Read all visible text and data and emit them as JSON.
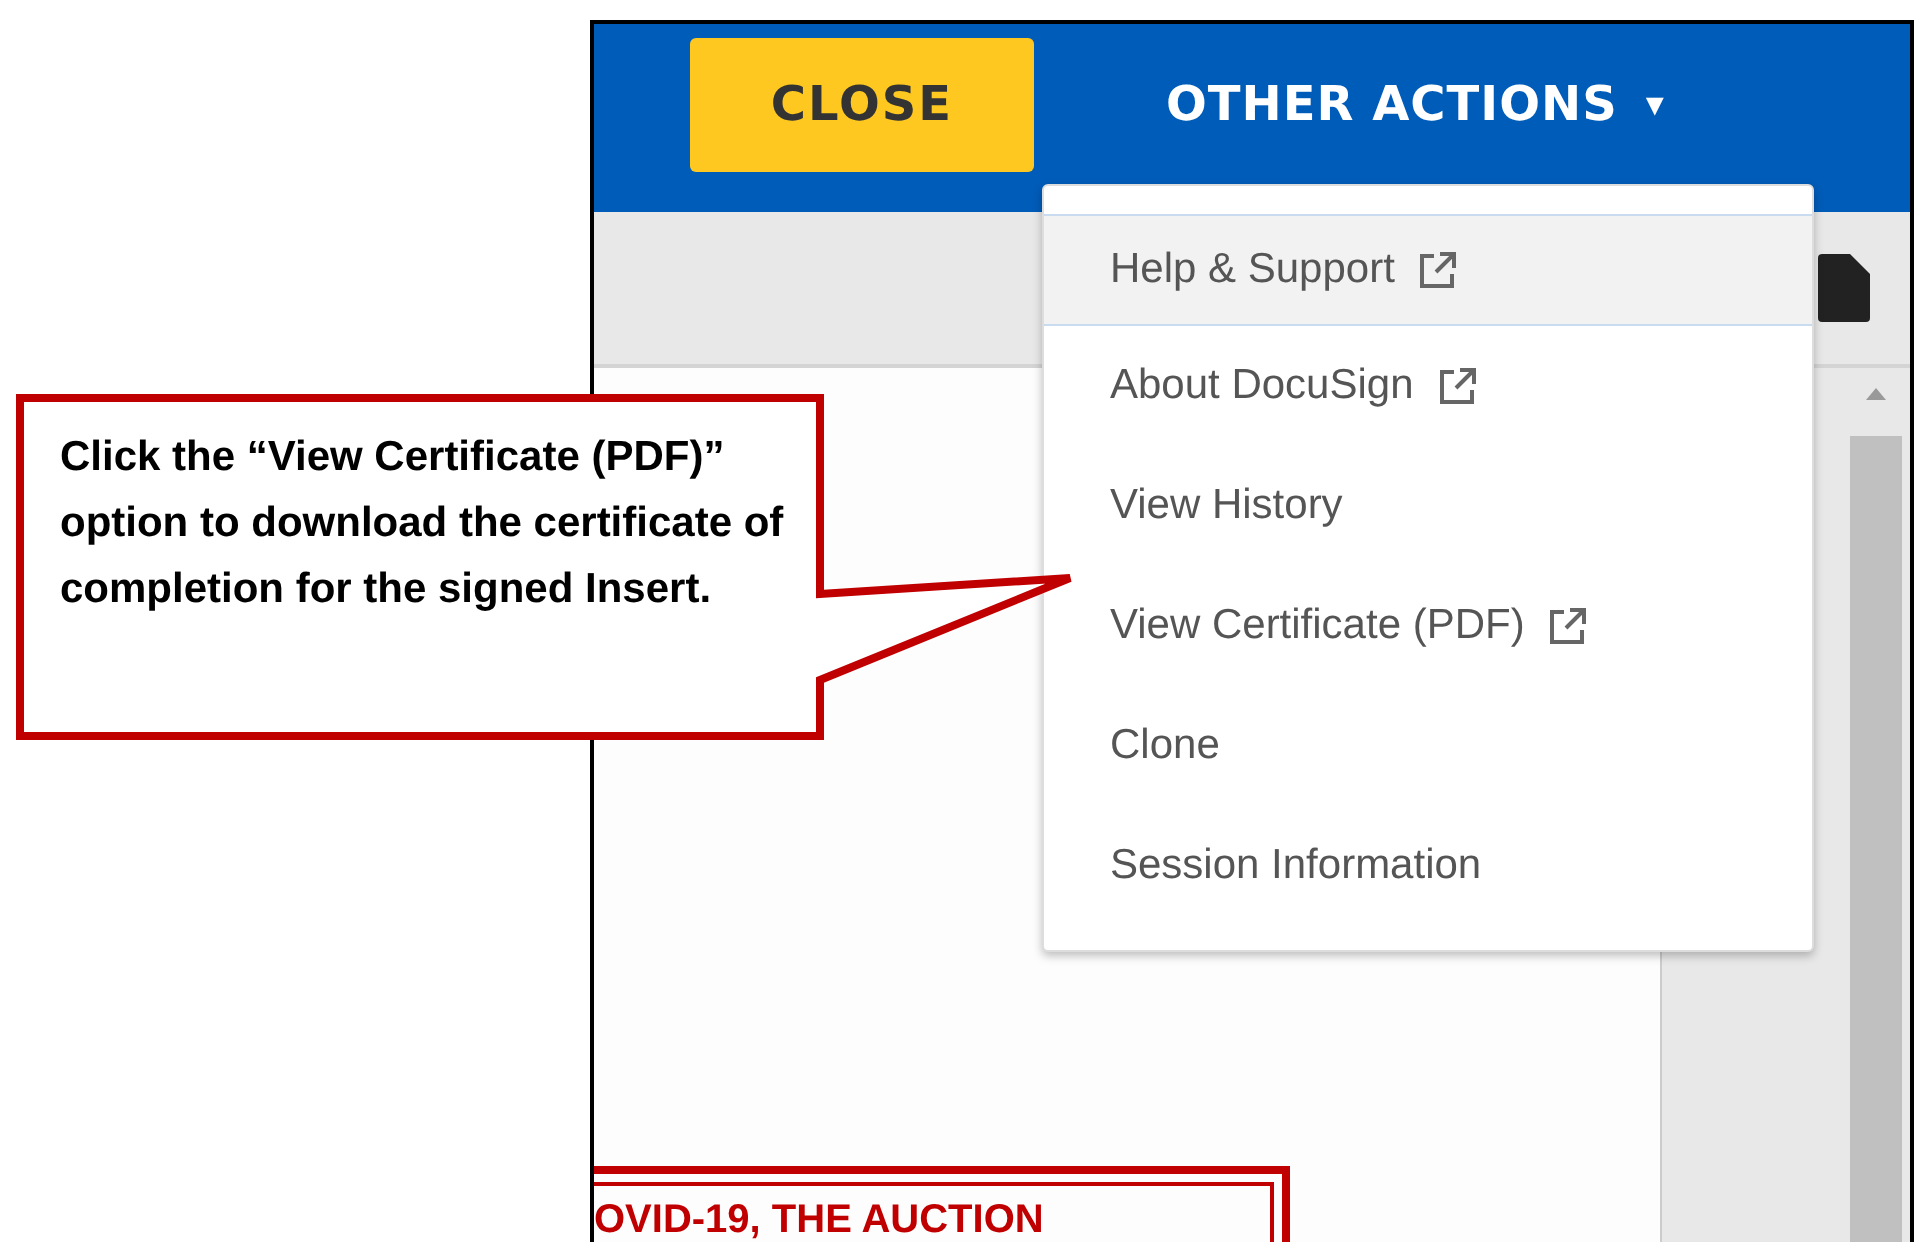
{
  "header": {
    "close_button": "CLOSE",
    "actions_menu": {
      "label": "OTHER ACTIONS",
      "caret": "▾"
    }
  },
  "menu": {
    "items": [
      {
        "label": "Help & Support",
        "external": true,
        "selected": true
      },
      {
        "label": "About DocuSign",
        "external": true,
        "selected": false
      },
      {
        "label": "View History",
        "external": false,
        "selected": false
      },
      {
        "label": "View Certificate (PDF)",
        "external": true,
        "selected": false
      },
      {
        "label": "Clone",
        "external": false,
        "selected": false
      },
      {
        "label": "Session Information",
        "external": false,
        "selected": false
      }
    ]
  },
  "document": {
    "heading": "OVID-19, THE AUCTION"
  },
  "callout": {
    "text": "Click the “View Certificate (PDF)” option to download the certificate of completion for the signed Insert."
  }
}
